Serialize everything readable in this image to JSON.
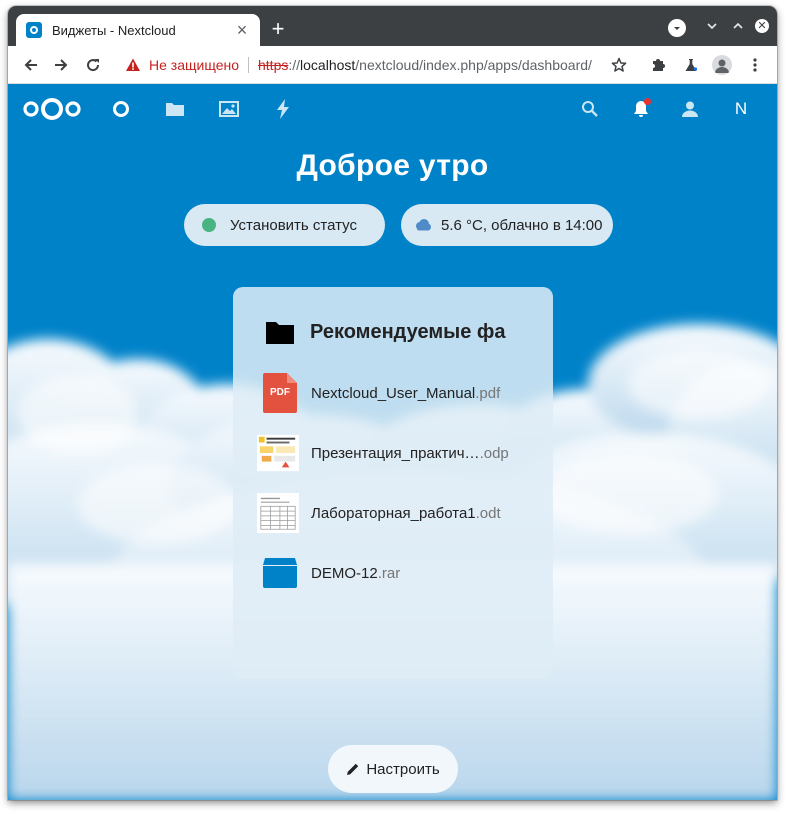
{
  "browser": {
    "tab_title": "Виджеты - Nextcloud",
    "tab_close": "×",
    "new_tab": "+",
    "security_warning": "Не защищено",
    "url_scheme": "https",
    "url_separator": "://",
    "url_host": "localhost",
    "url_path": "/nextcloud/index.php/apps/dashboard/"
  },
  "header": {
    "user_initial": "N",
    "notification_badge_color": "#e9322d"
  },
  "main": {
    "greeting": "Доброе утро",
    "status_label": "Установить статус",
    "status_color": "#49b382",
    "weather_label": "5.6 °C, облачно в 14:00"
  },
  "widget": {
    "title": "Рекомендуемые фа",
    "files": [
      {
        "name": "Nextcloud_User_Manual",
        "ext": ".pdf",
        "icon": "pdf-icon",
        "badge": "PDF"
      },
      {
        "name": "Презентация_практич…",
        "ext": ".odp",
        "icon": "presentation-thumbnail-icon"
      },
      {
        "name": "Лабораторная_работа1",
        "ext": ".odt",
        "icon": "document-thumbnail-icon"
      },
      {
        "name": "DEMO-12",
        "ext": ".rar",
        "icon": "archive-icon"
      }
    ]
  },
  "footer": {
    "customize_label": "Настроить"
  },
  "colors": {
    "brand": "#0082c9",
    "pdf": "#e2523f",
    "archive": "#0082c9"
  }
}
